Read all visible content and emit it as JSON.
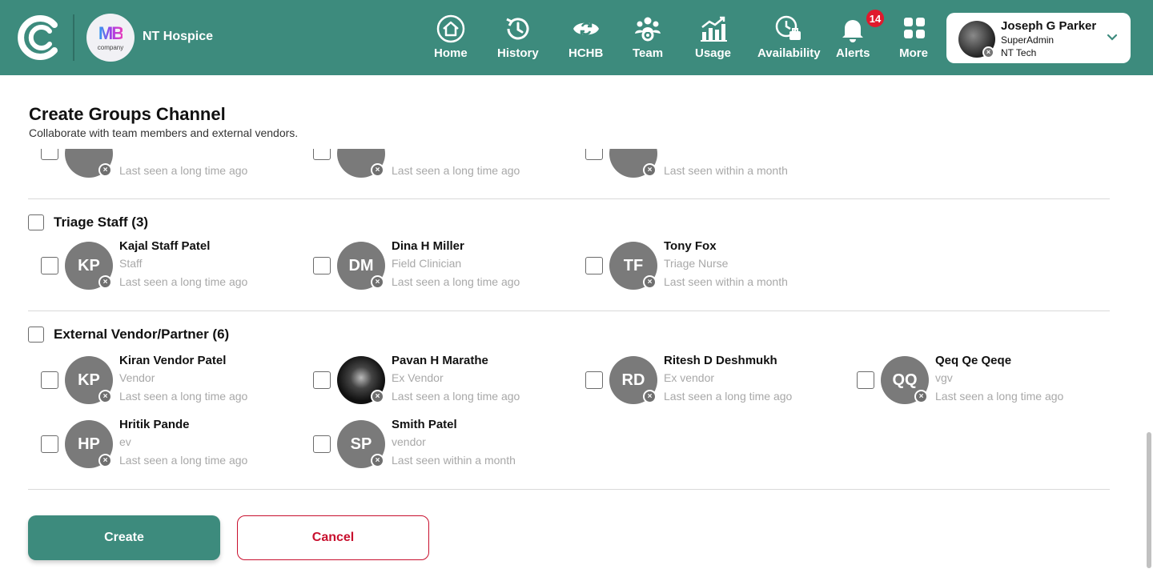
{
  "header": {
    "org_name": "NT Hospice",
    "company_logo_text": "MB",
    "company_logo_sub": "company",
    "nav": [
      {
        "id": "home",
        "label": "Home",
        "icon": "home-icon"
      },
      {
        "id": "history",
        "label": "History",
        "icon": "history-icon"
      },
      {
        "id": "hchb",
        "label": "HCHB",
        "icon": "sync-icon"
      },
      {
        "id": "team",
        "label": "Team",
        "icon": "team-icon"
      },
      {
        "id": "usage",
        "label": "Usage",
        "icon": "chart-icon"
      },
      {
        "id": "availability",
        "label": "Availability",
        "icon": "availability-icon"
      },
      {
        "id": "alerts",
        "label": "Alerts",
        "icon": "bell-icon",
        "badge": "14"
      },
      {
        "id": "more",
        "label": "More",
        "icon": "grid-icon"
      }
    ],
    "user": {
      "name": "Joseph G Parker",
      "role": "SuperAdmin",
      "org": "NT Tech"
    }
  },
  "page": {
    "title": "Create Groups Channel",
    "subtitle": "Collaborate with team members and external vendors."
  },
  "partial_row": [
    {
      "seen": "Last seen a long time ago"
    },
    {
      "seen": "Last seen a long time ago"
    },
    {
      "seen": "Last seen within a month"
    }
  ],
  "groups": [
    {
      "name": "Triage Staff (3)",
      "members": [
        {
          "initials": "KP",
          "name": "Kajal Staff Patel",
          "role": "Staff",
          "seen": "Last seen a long time ago"
        },
        {
          "initials": "DM",
          "name": "Dina H Miller",
          "role": "Field Clinician",
          "seen": "Last seen a long time ago"
        },
        {
          "initials": "TF",
          "name": "Tony Fox",
          "role": "Triage Nurse",
          "seen": "Last seen within a month"
        }
      ]
    },
    {
      "name": "External Vendor/Partner (6)",
      "members": [
        {
          "initials": "KP",
          "name": "Kiran Vendor Patel",
          "role": "Vendor",
          "seen": "Last seen a long time ago"
        },
        {
          "initials": "",
          "name": "Pavan H Marathe",
          "role": "Ex Vendor",
          "seen": "Last seen a long time ago"
        },
        {
          "initials": "RD",
          "name": "Ritesh D Deshmukh",
          "role": "Ex vendor",
          "seen": "Last seen a long time ago"
        },
        {
          "initials": "QQ",
          "name": "Qeq Qe Qeqe",
          "role": "vgv",
          "seen": "Last seen a long time ago"
        },
        {
          "initials": "HP",
          "name": "Hritik Pande",
          "role": "ev",
          "seen": "Last seen a long time ago"
        },
        {
          "initials": "SP",
          "name": "Smith Patel",
          "role": "vendor",
          "seen": "Last seen within a month"
        }
      ]
    }
  ],
  "actions": {
    "create_label": "Create",
    "cancel_label": "Cancel"
  },
  "colors": {
    "primary": "#3d8b7d",
    "danger": "#c8102e",
    "badge": "#e0192d",
    "avatar": "#7a7a7a"
  }
}
